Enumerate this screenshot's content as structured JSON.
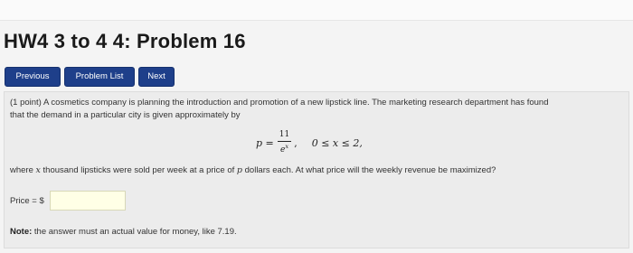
{
  "page": {
    "title": "HW4 3 to 4 4: Problem 16"
  },
  "nav": {
    "previous_label": "Previous",
    "problem_list_label": "Problem List",
    "next_label": "Next"
  },
  "problem": {
    "line1": "(1 point) A cosmetics company is planning the introduction and promotion of a new lipstick line. The marketing research department has found",
    "line2": "that the demand in a particular city is given approximately by",
    "formula_lhs": "p =",
    "formula_numerator": "11",
    "formula_denominator_base": "e",
    "formula_denominator_exponent": "x",
    "formula_domain": "0 ≤ x ≤ 2,",
    "question_part1": "where",
    "question_var_x": "x",
    "question_part2": "thousand lipsticks were sold per week at a price of",
    "question_var_p": "p",
    "question_part3": "dollars each. At what price will the weekly revenue be maximized?",
    "answer_label": "Price = $",
    "answer_value": "",
    "note_label": "Note:",
    "note_text": "the answer must an actual value for money, like 7.19."
  }
}
